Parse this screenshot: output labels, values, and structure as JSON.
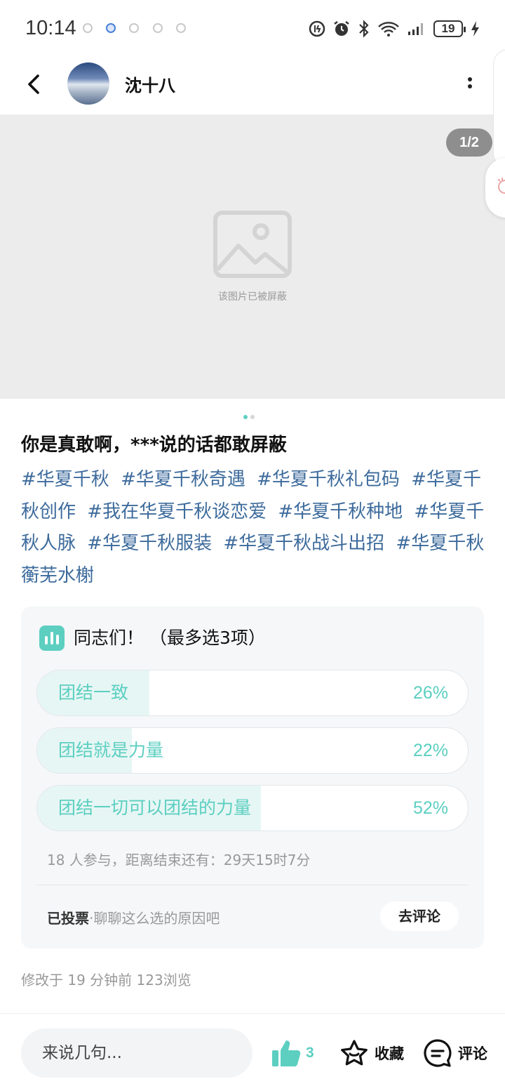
{
  "status_bar": {
    "time": "10:14",
    "battery": "19",
    "icons": [
      "mobile-data-icon",
      "alarm-icon",
      "bluetooth-icon",
      "wifi-icon",
      "signal-icon",
      "charging-icon"
    ]
  },
  "header": {
    "author_name": "沈十八"
  },
  "media": {
    "counter": "1/2",
    "blocked_text": "该图片已被屏蔽"
  },
  "post": {
    "title": "你是真敢啊，***说的话都敢屏蔽",
    "tags": [
      "#华夏千秋",
      "#华夏千秋奇遇",
      "#华夏千秋礼包码",
      "#华夏千秋创作",
      "#我在华夏千秋谈恋爱",
      "#华夏千秋种地",
      "#华夏千秋人脉",
      "#华夏千秋服装",
      "#华夏千秋战斗出招",
      "#华夏千秋蘅芜水榭"
    ],
    "meta": "修改于 19 分钟前 123浏览"
  },
  "poll": {
    "title": "同志们！  （最多选3项）",
    "options": [
      {
        "label": "团结一致",
        "percent": "26%",
        "share": 0.26
      },
      {
        "label": "团结就是力量",
        "percent": "22%",
        "share": 0.22
      },
      {
        "label": "团结一切可以团结的力量",
        "percent": "52%",
        "share": 0.52
      }
    ],
    "meta": "18 人参与，距离结束还有：29天15时7分",
    "voted_label": "已投票",
    "voted_hint": "·聊聊这么选的原因吧",
    "go_comment": "去评论"
  },
  "bottom_bar": {
    "input_placeholder": "来说几句...",
    "like_count": "3",
    "favorite_label": "收藏",
    "comment_label": "评论"
  },
  "colors": {
    "accent": "#5ccfc1",
    "tag_link": "#3d6b9c",
    "image_placeholder": "#ececec"
  }
}
